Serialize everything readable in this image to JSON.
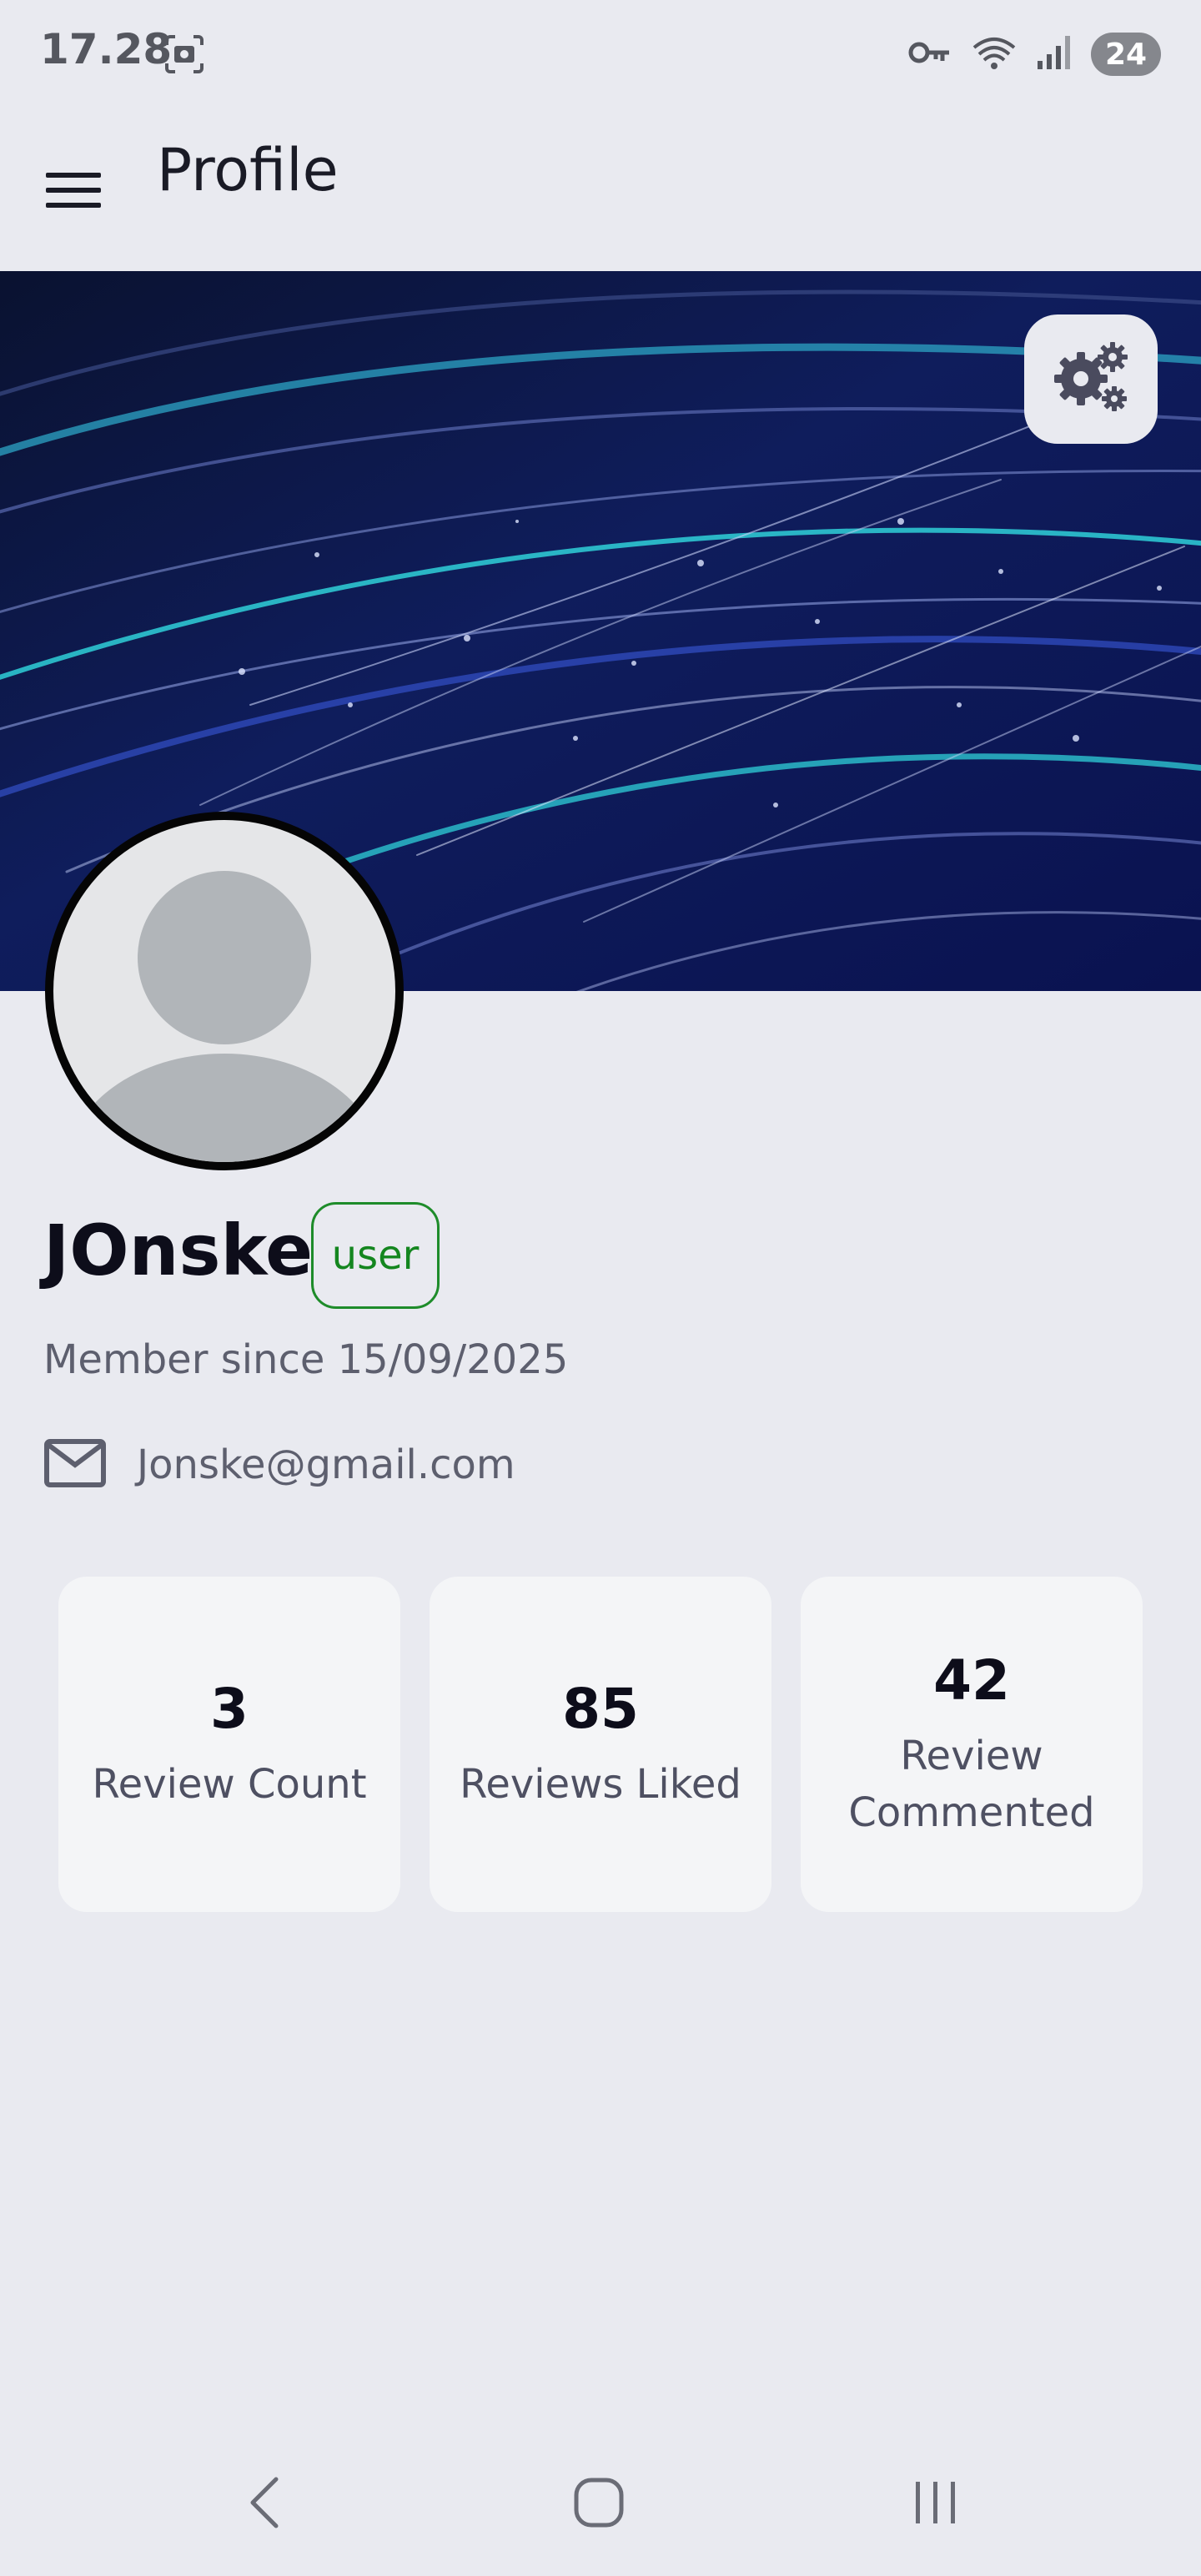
{
  "status_bar": {
    "time": "17.28",
    "battery": "24",
    "icons": [
      "screenshot-icon",
      "vpn-key-icon",
      "wifi-icon",
      "signal-icon",
      "battery-icon"
    ]
  },
  "app_bar": {
    "title": "Profile",
    "menu_icon": "hamburger-menu-icon"
  },
  "banner": {
    "settings_icon": "gears-icon"
  },
  "profile": {
    "username": "JOnske",
    "role": "user",
    "member_since": "Member since 15/09/2025",
    "email": "Jonske@gmail.com"
  },
  "stats": [
    {
      "value": "3",
      "label": "Review Count"
    },
    {
      "value": "85",
      "label": "Reviews Liked"
    },
    {
      "value": "42",
      "label": "Review Commented"
    }
  ],
  "nav_bar": {
    "icons": [
      "back-icon",
      "home-icon",
      "recent-apps-icon"
    ]
  },
  "colors": {
    "background": "#e9eaf0",
    "card": "#f4f5f7",
    "badge_green": "#14861f",
    "banner_navy": "#0b1445",
    "accent_cyan": "#2fd0d8"
  }
}
